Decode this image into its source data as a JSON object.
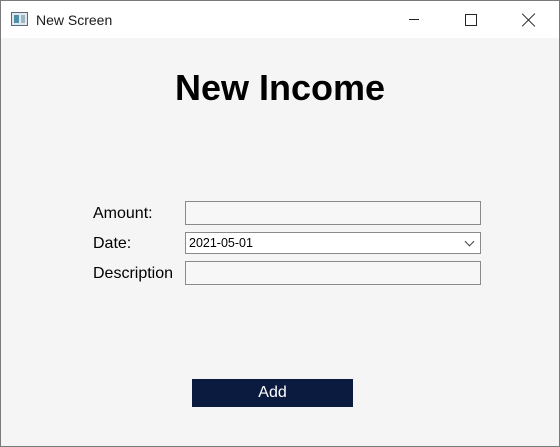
{
  "window": {
    "title": "New Screen",
    "icon": "app-window-icon"
  },
  "titlebar_buttons": {
    "minimize_icon": "minimize-icon",
    "maximize_icon": "maximize-icon",
    "close_icon": "close-icon"
  },
  "form": {
    "heading": "New Income",
    "amount_label": "Amount:",
    "amount_value": "",
    "date_label": "Date:",
    "date_value": "2021-05-01",
    "description_label": "Description",
    "description_value": ""
  },
  "actions": {
    "add_label": "Add"
  },
  "colors": {
    "button_background": "#0b1a3f",
    "window_background": "#f5f5f5"
  }
}
